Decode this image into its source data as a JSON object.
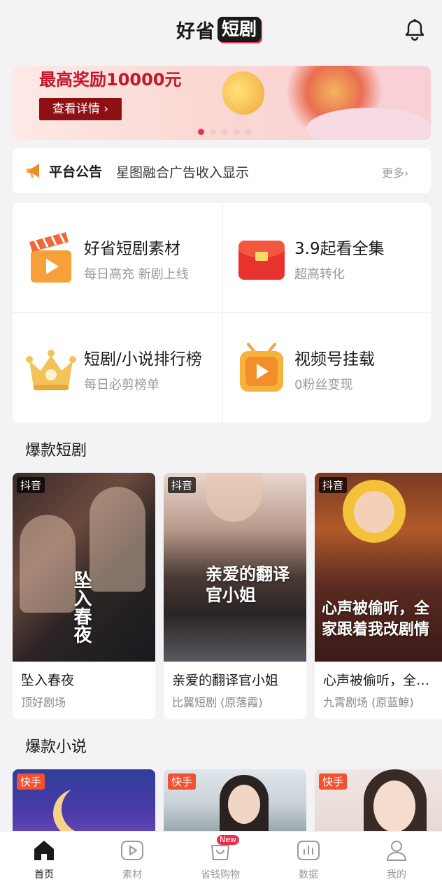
{
  "app": {
    "logo_part1": "好省",
    "logo_part2": "短剧"
  },
  "banner": {
    "headline": "最高奖励10000元",
    "button_label": "查看详情 ›",
    "slide_count": 5,
    "active_slide": 1
  },
  "notice": {
    "title": "平台公告",
    "text": "星图融合广告收入显示",
    "more_label": "更多›"
  },
  "features": [
    {
      "title": "好省短剧素材",
      "subtitle": "每日高充 新剧上线",
      "icon": "clapperboard-play-icon"
    },
    {
      "title": "3.9起看全集",
      "subtitle": "超高转化",
      "icon": "red-envelope-icon"
    },
    {
      "title": "短剧/小说排行榜",
      "subtitle": "每日必剪榜单",
      "icon": "crown-icon"
    },
    {
      "title": "视频号挂载",
      "subtitle": "0粉丝变现",
      "icon": "tv-play-icon"
    }
  ],
  "sections": {
    "dramas": "爆款短剧",
    "novels": "爆款小说"
  },
  "dramas": [
    {
      "platform": "抖音",
      "title": "坠入春夜",
      "studio": "顶好剧场",
      "poster_text": "坠入春夜"
    },
    {
      "platform": "抖音",
      "title": "亲爱的翻译官小姐",
      "studio": "比翼短剧 (原落霞)",
      "poster_text": "亲爱的翻译官小姐"
    },
    {
      "platform": "抖音",
      "title": "心声被偷听，全…",
      "studio": "九霄剧场 (原蓝鲸)",
      "poster_text": "心声被偷听，全家跟着我改剧情"
    }
  ],
  "novels": [
    {
      "platform": "快手"
    },
    {
      "platform": "快手"
    },
    {
      "platform": "快手"
    }
  ],
  "tabbar": [
    {
      "label": "首页",
      "icon": "home-icon",
      "active": true
    },
    {
      "label": "素材",
      "icon": "play-square-icon",
      "active": false
    },
    {
      "label": "省钱购物",
      "icon": "shopping-bag-icon",
      "active": false,
      "badge": "New"
    },
    {
      "label": "数据",
      "icon": "bar-chart-icon",
      "active": false
    },
    {
      "label": "我的",
      "icon": "user-icon",
      "active": false
    }
  ],
  "colors": {
    "accent": "#e8324b",
    "background": "#f3f3f5",
    "kuaishou": "#f2502f"
  }
}
